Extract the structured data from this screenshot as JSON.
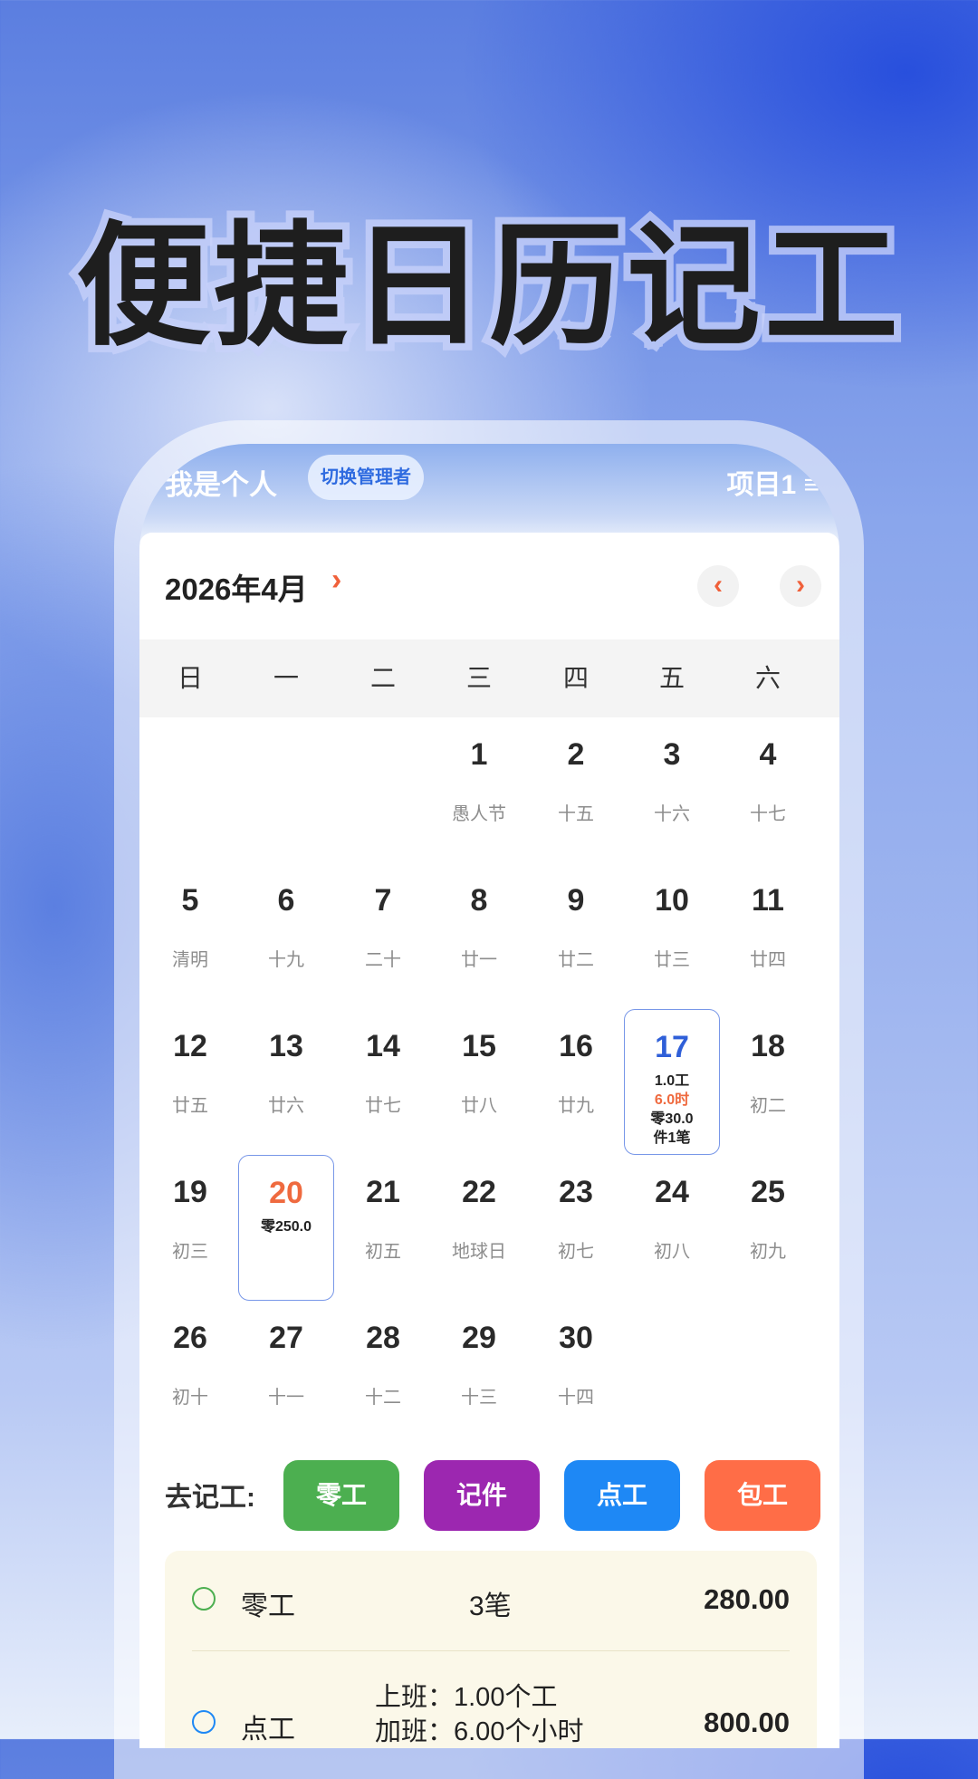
{
  "headline": "便捷日历记工",
  "topbar": {
    "role": "我是个人",
    "switch_label": "切换管理者",
    "project": "项目1 ≡"
  },
  "calendar": {
    "month_title": "2026年4月",
    "month_arrow": "›",
    "prev": "‹",
    "next": "›",
    "weekdays": [
      "日",
      "一",
      "二",
      "三",
      "四",
      "五",
      "六"
    ],
    "days": [
      {
        "d": "1",
        "sub": "愚人节"
      },
      {
        "d": "2",
        "sub": "十五"
      },
      {
        "d": "3",
        "sub": "十六"
      },
      {
        "d": "4",
        "sub": "十七"
      },
      {
        "d": "5",
        "sub": "清明"
      },
      {
        "d": "6",
        "sub": "十九"
      },
      {
        "d": "7",
        "sub": "二十"
      },
      {
        "d": "8",
        "sub": "廿一"
      },
      {
        "d": "9",
        "sub": "廿二"
      },
      {
        "d": "10",
        "sub": "廿三"
      },
      {
        "d": "11",
        "sub": "廿四"
      },
      {
        "d": "12",
        "sub": "廿五"
      },
      {
        "d": "13",
        "sub": "廿六"
      },
      {
        "d": "14",
        "sub": "廿七"
      },
      {
        "d": "15",
        "sub": "廿八"
      },
      {
        "d": "16",
        "sub": "廿九"
      },
      {
        "d": "17",
        "lines": [
          "1.0工",
          "6.0时",
          "零30.0",
          "件1笔"
        ]
      },
      {
        "d": "18",
        "sub": "初二"
      },
      {
        "d": "19",
        "sub": "初三"
      },
      {
        "d": "20",
        "lines": [
          "零250.0"
        ]
      },
      {
        "d": "21",
        "sub": "初五"
      },
      {
        "d": "22",
        "sub": "地球日"
      },
      {
        "d": "23",
        "sub": "初七"
      },
      {
        "d": "24",
        "sub": "初八"
      },
      {
        "d": "25",
        "sub": "初九"
      },
      {
        "d": "26",
        "sub": "初十"
      },
      {
        "d": "27",
        "sub": "十一"
      },
      {
        "d": "28",
        "sub": "十二"
      },
      {
        "d": "29",
        "sub": "十三"
      },
      {
        "d": "30",
        "sub": "十四"
      }
    ]
  },
  "record": {
    "label": "去记工:",
    "buttons": [
      {
        "label": "零工",
        "color": "#4caf50"
      },
      {
        "label": "记件",
        "color": "#9c27b0"
      },
      {
        "label": "点工",
        "color": "#1e88f5"
      },
      {
        "label": "包工",
        "color": "#ff6d47"
      }
    ]
  },
  "summary": {
    "rows": [
      {
        "label": "零工",
        "count": "3笔",
        "amount": "280.00",
        "radio_color": "#4caf50"
      },
      {
        "label": "点工",
        "detail": [
          "上班：1.00个工",
          "加班：6.00个小时"
        ],
        "amount": "800.00",
        "radio_color": "#1e88f5"
      }
    ]
  }
}
